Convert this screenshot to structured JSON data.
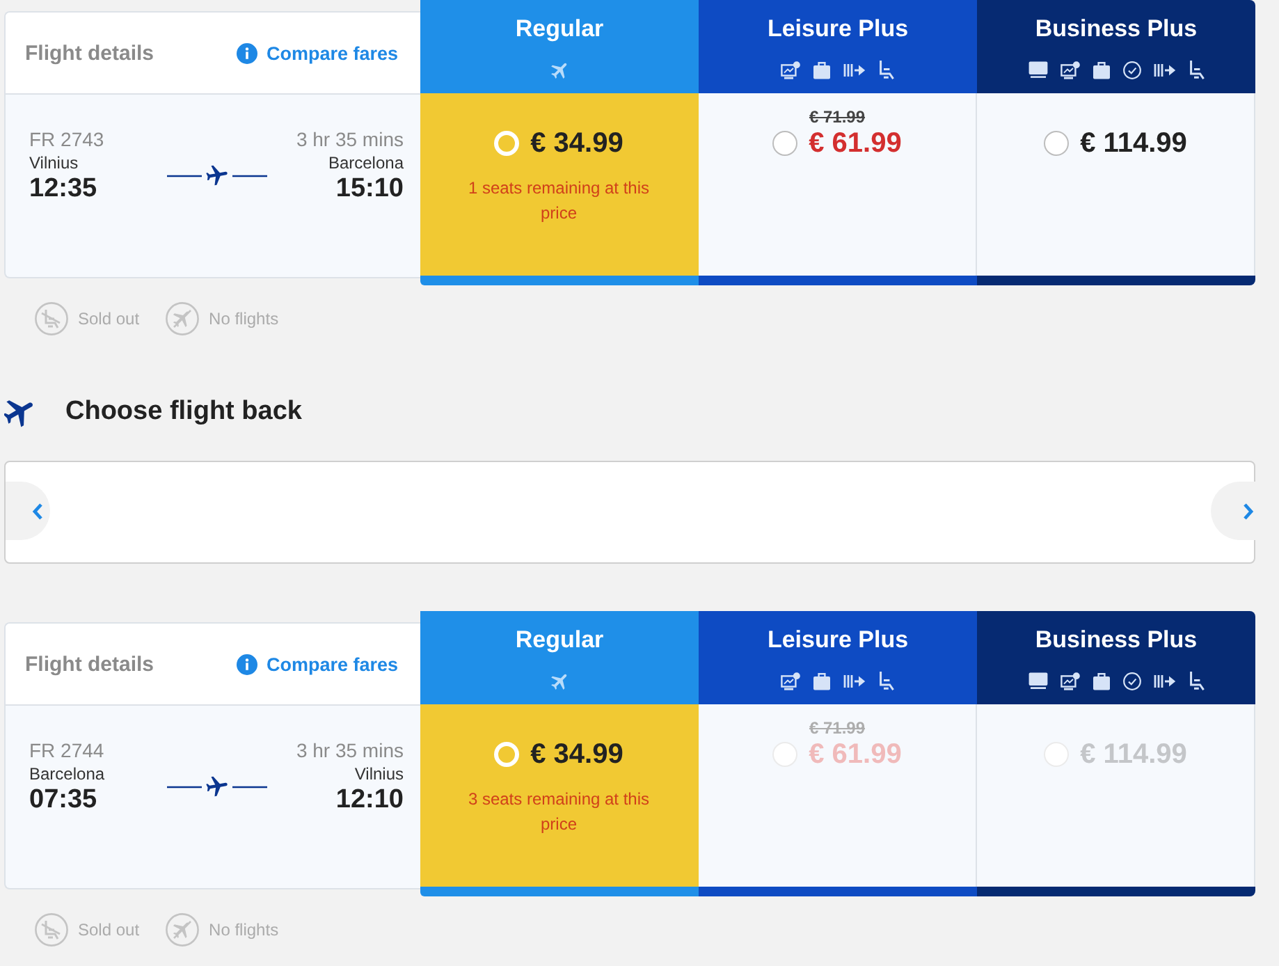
{
  "sections": [
    {
      "kind": "journey",
      "details_title": "Flight details",
      "compare_link": "Compare fares",
      "flight": {
        "number": "FR 2743",
        "duration": "3 hr 35 mins",
        "origin": "Vilnius",
        "departure": "12:35",
        "destination": "Barcelona",
        "arrival": "15:10"
      },
      "fares": [
        {
          "kind": "regular",
          "name": "Regular",
          "price": "€ 34.99",
          "selected": true,
          "disabled": false,
          "note": "1 seats remaining at this price"
        },
        {
          "kind": "leisure",
          "name": "Leisure Plus",
          "old_price": "€ 71.99",
          "price": "€ 61.99",
          "selected": false,
          "disabled": false
        },
        {
          "kind": "business",
          "name": "Business Plus",
          "price": "€ 114.99",
          "selected": false,
          "disabled": false
        }
      ],
      "legend": [
        {
          "kind": "soldout",
          "label": "Sold out"
        },
        {
          "kind": "noflight",
          "label": "No flights"
        }
      ]
    },
    {
      "kind": "heading",
      "title": "Choose flight back"
    },
    {
      "kind": "carousel"
    },
    {
      "kind": "journey",
      "details_title": "Flight details",
      "compare_link": "Compare fares",
      "flight": {
        "number": "FR 2744",
        "duration": "3 hr 35 mins",
        "origin": "Barcelona",
        "departure": "07:35",
        "destination": "Vilnius",
        "arrival": "12:10"
      },
      "fares": [
        {
          "kind": "regular",
          "name": "Regular",
          "price": "€ 34.99",
          "selected": true,
          "disabled": false,
          "note": "3 seats remaining at this price"
        },
        {
          "kind": "leisure",
          "name": "Leisure Plus",
          "old_price": "€ 71.99",
          "price": "€ 61.99",
          "selected": false,
          "disabled": true
        },
        {
          "kind": "business",
          "name": "Business Plus",
          "price": "€ 114.99",
          "selected": false,
          "disabled": true
        }
      ],
      "legend": [
        {
          "kind": "soldout",
          "label": "Sold out"
        },
        {
          "kind": "noflight",
          "label": "No flights"
        }
      ]
    }
  ]
}
